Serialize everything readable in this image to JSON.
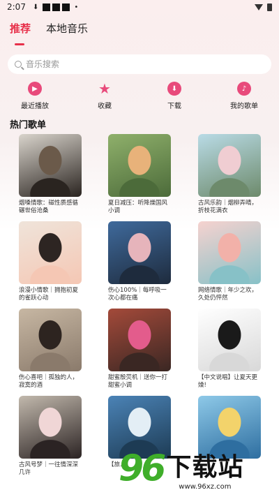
{
  "status": {
    "time": "2:07"
  },
  "tabs": [
    {
      "label": "推荐",
      "active": true
    },
    {
      "label": "本地音乐",
      "active": false
    }
  ],
  "search": {
    "placeholder": "音乐搜索"
  },
  "quick_actions": [
    {
      "label": "最近播放",
      "icon": "play-circle-icon"
    },
    {
      "label": "收藏",
      "icon": "star-icon"
    },
    {
      "label": "下载",
      "icon": "download-icon"
    },
    {
      "label": "我的歌单",
      "icon": "music-note-icon"
    }
  ],
  "section": {
    "title": "热门歌单"
  },
  "playlists": [
    {
      "title": "烟嗓情歌：磁性质感循碾世俗沧桑",
      "colors": [
        "#d9d4cc",
        "#6b5a4a",
        "#2a2420"
      ]
    },
    {
      "title": "夏日减压：听降燥国风小调",
      "colors": [
        "#8fb06b",
        "#e8b27a",
        "#4c6b3a"
      ]
    },
    {
      "title": "古风乐韵｜烟柳弄晴，折枝花满衣",
      "colors": [
        "#b9dbe6",
        "#f0cdd2",
        "#6d8a6b"
      ]
    },
    {
      "title": "浪漫小情歌｜拥抱初夏的雀跃心动",
      "colors": [
        "#efe4da",
        "#2d2522",
        "#f5c7b4"
      ]
    },
    {
      "title": "伤心100%｜每呼吸一次心都在痛",
      "colors": [
        "#3f6a9c",
        "#e6b4bb",
        "#1e2b3d"
      ]
    },
    {
      "title": "网络情歌｜年少之欢，久处仍怦然",
      "colors": [
        "#f6d2cf",
        "#f2b1a9",
        "#87c1c7"
      ]
    },
    {
      "title": "伤心喜吧｜孤独的人，寂寞的酒",
      "colors": [
        "#c7b7a3",
        "#2d2420",
        "#8a7a6b"
      ]
    },
    {
      "title": "甜蜜殷荧机｜送你一打甜蜜小调",
      "colors": [
        "#a44a3a",
        "#e35c8c",
        "#3a2723"
      ]
    },
    {
      "title": "【中文说唱】让夏天更燥!",
      "colors": [
        "#ffffff",
        "#1a1a1a",
        "#d8d8d8"
      ]
    },
    {
      "title": "古风号梦｜一往情深深几许",
      "colors": [
        "#c2b9ad",
        "#f0d6d6",
        "#2b2323"
      ]
    },
    {
      "title": "【旅...",
      "colors": [
        "#4b83b6",
        "#e3eef5",
        "#1d3b54"
      ]
    },
    {
      "title": "",
      "colors": [
        "#8ec9e8",
        "#f3d36b",
        "#2e6ea0"
      ]
    }
  ],
  "watermark": {
    "number": "96",
    "brand": "下载站",
    "url": "www.96xz.com"
  }
}
